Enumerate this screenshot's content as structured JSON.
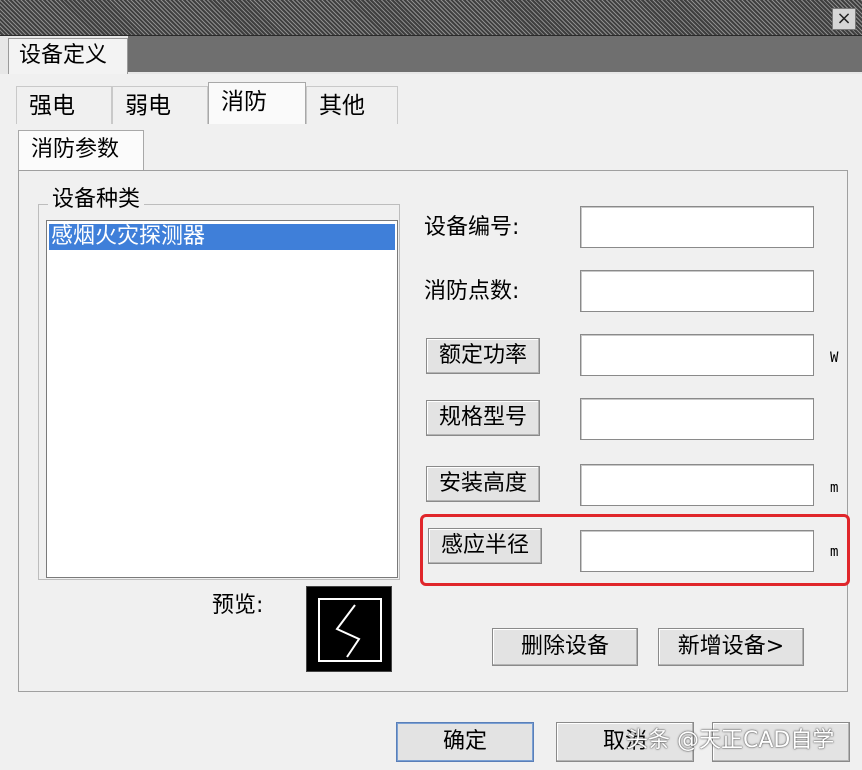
{
  "window": {
    "close_symbol": "×"
  },
  "device_tab": {
    "label": "设备定义"
  },
  "tabs": [
    {
      "label": "强电"
    },
    {
      "label": "弱电"
    },
    {
      "label": "消防",
      "active": true
    },
    {
      "label": "其他"
    }
  ],
  "subtab": {
    "label": "消防参数"
  },
  "device_types": {
    "title": "设备种类",
    "items": [
      {
        "label": "感烟火灾探测器",
        "selected": true
      }
    ]
  },
  "preview": {
    "label": "预览:"
  },
  "fields": {
    "device_no": {
      "label": "设备编号:",
      "value": ""
    },
    "fire_points": {
      "label": "消防点数:",
      "value": ""
    },
    "rated_power": {
      "label": "额定功率",
      "value": "",
      "unit": "W"
    },
    "spec_model": {
      "label": "规格型号",
      "value": ""
    },
    "install_height": {
      "label": "安装高度",
      "value": "",
      "unit": "m"
    },
    "sensing_radius": {
      "label": "感应半径",
      "value": "",
      "unit": "m"
    }
  },
  "actions": {
    "delete_device": "删除设备",
    "add_device": "新增设备>",
    "ok": "确定",
    "cancel": "取消"
  },
  "watermark": {
    "text": "头条 @天正CAD自学"
  },
  "colors": {
    "selection": "#3f7fd9",
    "highlight": "#e0262b"
  },
  "icons": {
    "close": "close-icon",
    "preview": "preview-symbol-icon"
  }
}
